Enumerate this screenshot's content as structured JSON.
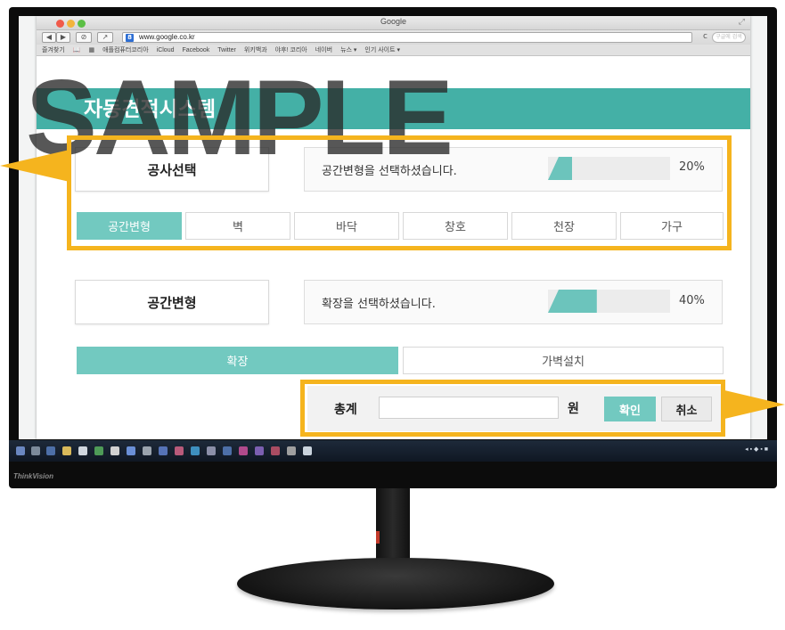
{
  "browser": {
    "window_title": "Google",
    "address": "www.google.co.kr",
    "favicon_letter": "8",
    "search_placeholder": "구글에 검색",
    "bookmarks": [
      "즐겨찾기",
      "애플컴퓨터코리아",
      "iCloud",
      "Facebook",
      "Twitter",
      "위키백과",
      "야후! 코리아",
      "네이버",
      "뉴스 ▾",
      "인기 사이트 ▾"
    ]
  },
  "app": {
    "title": "자동견적시스템",
    "watermark": "SAMPLE"
  },
  "section1": {
    "label": "공사선택",
    "status": "공간변형을 선택하셨습니다.",
    "progress": 0.2,
    "progress_text": "20%",
    "tabs": [
      {
        "label": "공간변형",
        "active": true
      },
      {
        "label": "벽",
        "active": false
      },
      {
        "label": "바닥",
        "active": false
      },
      {
        "label": "창호",
        "active": false
      },
      {
        "label": "천장",
        "active": false
      },
      {
        "label": "가구",
        "active": false
      }
    ]
  },
  "section2": {
    "label": "공간변형",
    "status": "확장을 선택하셨습니다.",
    "progress": 0.4,
    "progress_text": "40%",
    "tabs": [
      {
        "label": "확장",
        "active": true
      },
      {
        "label": "가벽설치",
        "active": false
      }
    ]
  },
  "total": {
    "label": "총계",
    "value": "",
    "unit": "원",
    "confirm_label": "확인",
    "cancel_label": "취소"
  },
  "monitor": {
    "brand": "ThinkVision"
  },
  "colors": {
    "accent": "#44b0a6",
    "tab_active": "#72c9c0",
    "callout": "#f5b41e"
  }
}
